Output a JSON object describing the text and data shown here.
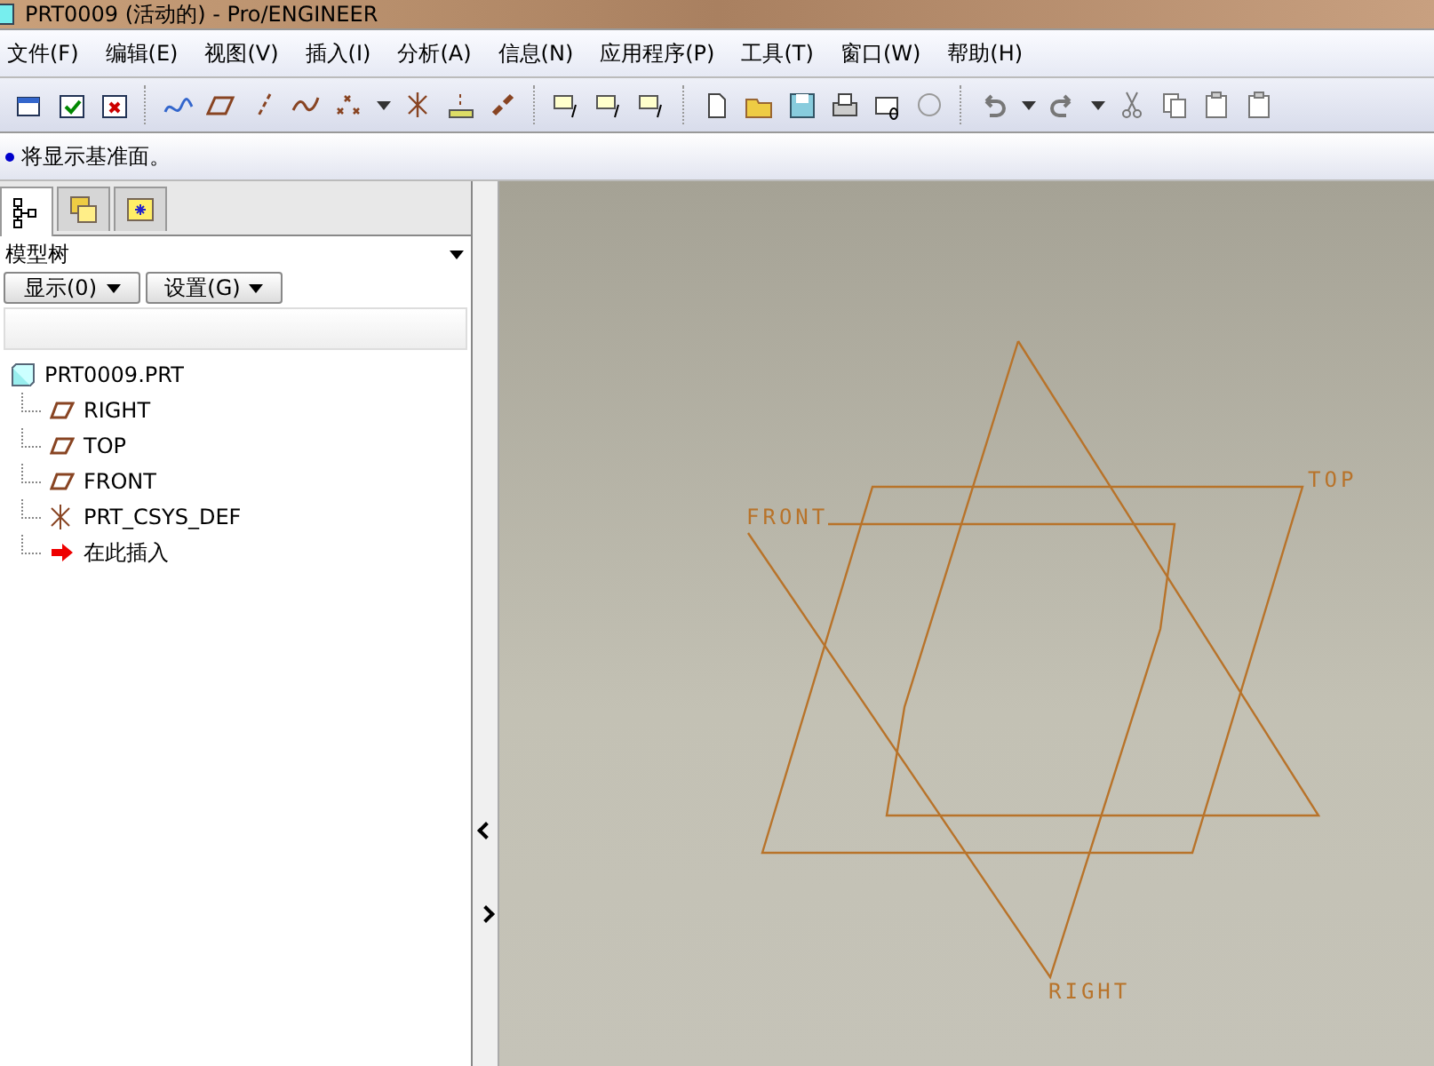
{
  "window": {
    "title": "PRT0009 (活动的) - Pro/ENGINEER"
  },
  "menu": [
    "文件(F)",
    "编辑(E)",
    "视图(V)",
    "插入(I)",
    "分析(A)",
    "信息(N)",
    "应用程序(P)",
    "工具(T)",
    "窗口(W)",
    "帮助(H)"
  ],
  "message": "将显示基准面。",
  "panel": {
    "tabs": [
      {
        "kind": "tree",
        "selected": true
      },
      {
        "kind": "folders",
        "selected": false
      },
      {
        "kind": "favorites",
        "selected": false
      }
    ],
    "title": "模型树",
    "buttons": [
      "显示(0)",
      "设置(G)"
    ],
    "tree": [
      {
        "label": "PRT0009.PRT",
        "kind": "part",
        "children": [
          {
            "label": "RIGHT",
            "kind": "plane"
          },
          {
            "label": "TOP",
            "kind": "plane"
          },
          {
            "label": "FRONT",
            "kind": "plane"
          },
          {
            "label": "PRT_CSYS_DEF",
            "kind": "csys"
          },
          {
            "label": "在此插入",
            "kind": "insert"
          }
        ]
      }
    ]
  },
  "canvas": {
    "labels": [
      {
        "text": "FRONT",
        "kind": "front"
      },
      {
        "text": "TOP",
        "kind": "top"
      },
      {
        "text": "RIGHT",
        "kind": "right"
      }
    ]
  }
}
